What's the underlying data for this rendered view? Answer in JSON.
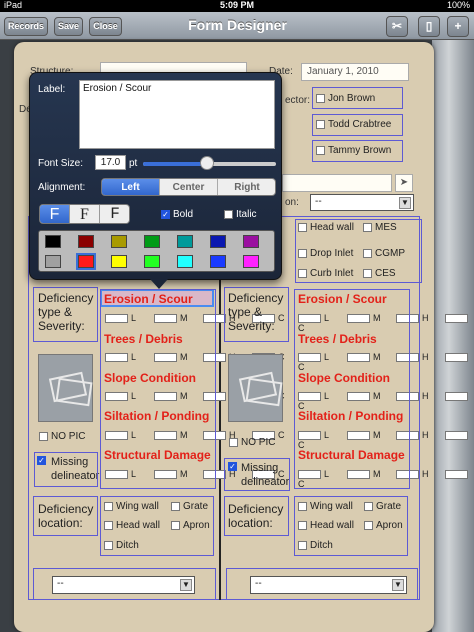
{
  "status": {
    "carrier": "iPad",
    "time": "5:09 PM",
    "battery": "100%"
  },
  "nav": {
    "title": "Form Designer",
    "records": "Records",
    "save": "Save",
    "close": "Close",
    "plus": "+"
  },
  "form": {
    "structure_label": "Structure:",
    "de_label": "De",
    "date_label": "Date:",
    "date_value": "January 1, 2010",
    "inspector_label": "ector:",
    "inspectors": [
      "Jon Brown",
      "Todd Crabtree",
      "Tammy Brown"
    ],
    "on_label": "on:",
    "select_value": "--",
    "types": [
      "Head wall",
      "MES",
      "Drop Inlet",
      "CGMP",
      "Curb Inlet",
      "CES"
    ],
    "deficiency_type": "Deficiency type & Severity:",
    "deficiencies": [
      "Erosion / Scour",
      "Trees / Debris",
      "Slope Condition",
      "Siltation / Ponding",
      "Structural Damage"
    ],
    "severity": [
      "L",
      "M",
      "H",
      "C"
    ],
    "no_pic": "NO PIC",
    "missing": "Missing delineator",
    "location_label": "Deficiency location:",
    "locations": [
      "Wing wall",
      "Grate",
      "Head wall",
      "Apron",
      "Ditch"
    ],
    "bottom_select": "--"
  },
  "popover": {
    "label": "Label:",
    "label_value": "Erosion / Scour",
    "font_size_label": "Font Size:",
    "font_size": "17.0",
    "font_unit": "pt",
    "font_size_level": 0.48,
    "alignment_label": "Alignment:",
    "alignments": [
      "Left",
      "Center",
      "Right"
    ],
    "fonts": [
      "F",
      "F",
      "F"
    ],
    "bold": "Bold",
    "italic": "Italic",
    "colors_row1": [
      "#000000",
      "#8b0000",
      "#a89a00",
      "#009b16",
      "#009a9a",
      "#0a18b0",
      "#9a0fa0"
    ],
    "colors_row2": [
      "#a0a0a0",
      "#ff1a1a",
      "#ffff00",
      "#22ff22",
      "#22ffff",
      "#1a3aff",
      "#ff22ff"
    ]
  }
}
